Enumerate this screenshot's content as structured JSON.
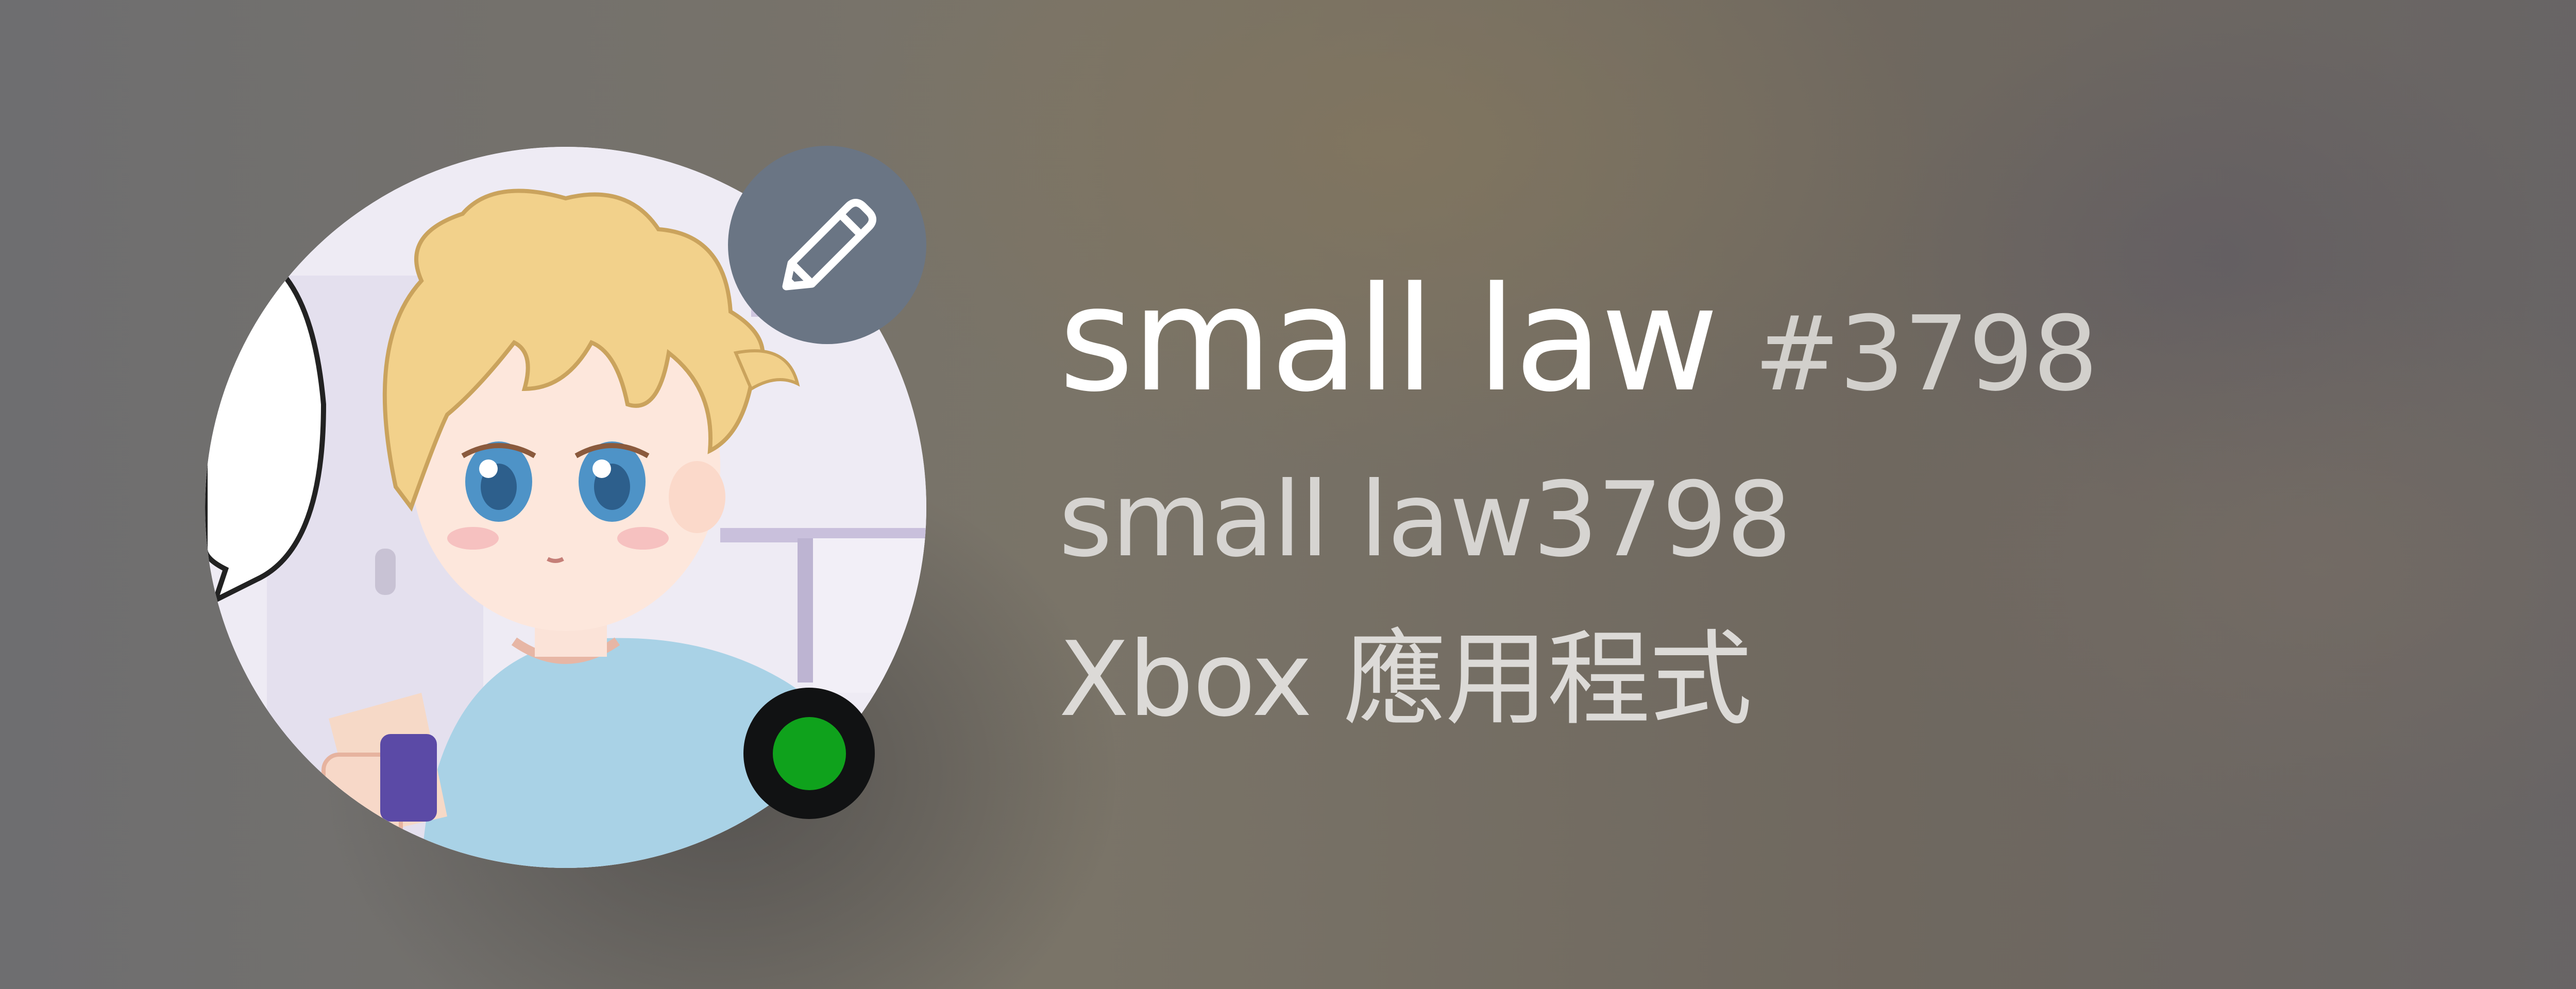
{
  "profile": {
    "display_name": "small law",
    "tag": "#3798",
    "username": "small law3798",
    "activity": "Xbox 應用程式",
    "status": "online",
    "status_color": "#0fa21c"
  },
  "icons": {
    "edit": "pencil-icon",
    "avatar": "anime-boy-avatar"
  },
  "colors": {
    "edit_button_bg": "#6a7584",
    "status_ring": "#111213"
  }
}
